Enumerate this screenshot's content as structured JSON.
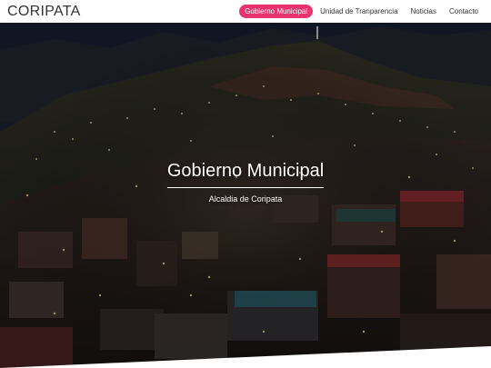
{
  "navbar": {
    "brand": "CORIPATA",
    "items": [
      {
        "label": "Gobierno Municipal",
        "active": true
      },
      {
        "label": "Unidad de Tranparencia",
        "active": false
      },
      {
        "label": "Noticias",
        "active": false
      },
      {
        "label": "Contacto",
        "active": false
      }
    ]
  },
  "hero": {
    "title": "Gobierno Municipal",
    "subtitle": "Alcaldia de Coripata"
  },
  "colors": {
    "accent": "#e8336d",
    "navbar_bg": "#ffffff",
    "hero_text": "#ffffff"
  }
}
